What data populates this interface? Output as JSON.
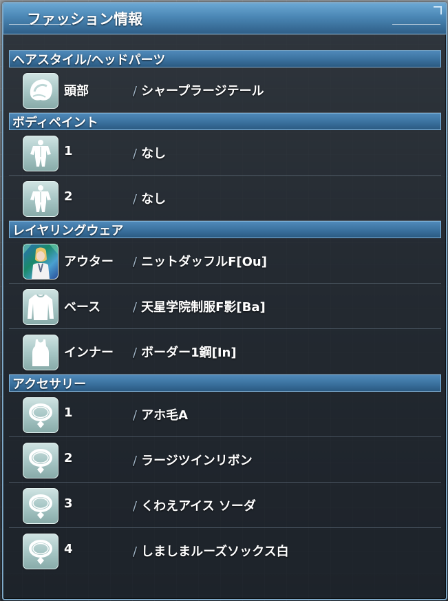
{
  "window": {
    "title": "ファッション情報"
  },
  "sections": {
    "hair": {
      "header": "ヘアスタイル/ヘッドパーツ",
      "rows": [
        {
          "label": "頭部",
          "value": "シャープラージテール",
          "icon": "hair-icon"
        }
      ]
    },
    "bodypaint": {
      "header": "ボディペイント",
      "rows": [
        {
          "label": "1",
          "value": "なし",
          "icon": "body-icon"
        },
        {
          "label": "2",
          "value": "なし",
          "icon": "body-icon"
        }
      ]
    },
    "layering": {
      "header": "レイヤリングウェア",
      "rows": [
        {
          "label": "アウター",
          "value": "ニットダッフルF[Ou]",
          "icon": "character-portrait-icon"
        },
        {
          "label": "ベース",
          "value": "天星学院制服F影[Ba]",
          "icon": "longsleeve-shirt-icon"
        },
        {
          "label": "インナー",
          "value": "ボーダー1鋼[In]",
          "icon": "tank-top-icon"
        }
      ]
    },
    "accessory": {
      "header": "アクセサリー",
      "rows": [
        {
          "label": "1",
          "value": "アホ毛A",
          "icon": "necklace-icon"
        },
        {
          "label": "2",
          "value": "ラージツインリボン",
          "icon": "necklace-icon"
        },
        {
          "label": "3",
          "value": "くわえアイス ソーダ",
          "icon": "necklace-icon"
        },
        {
          "label": "4",
          "value": "しましまルーズソックス白",
          "icon": "necklace-icon"
        }
      ]
    }
  },
  "separator": "/",
  "colors": {
    "accent": "#4a86b4",
    "header_bar": "#3a719e",
    "icon_bg": "#a8c7c6"
  }
}
